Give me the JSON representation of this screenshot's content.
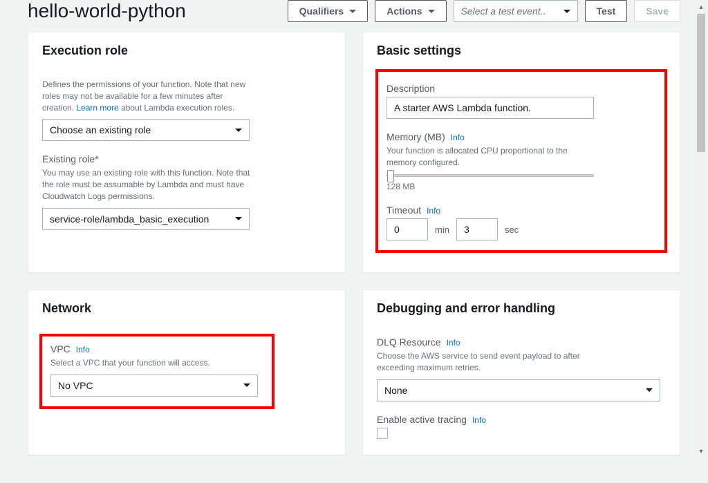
{
  "header": {
    "title": "hello-world-python",
    "qualifiers_label": "Qualifiers",
    "actions_label": "Actions",
    "test_event_placeholder": "Select a test event..",
    "test_label": "Test",
    "save_label": "Save"
  },
  "execution_role": {
    "title": "Execution role",
    "description_prefix": "Defines the permissions of your function. Note that new roles may not be available for a few minutes after creation. ",
    "learn_more": "Learn more",
    "description_suffix": " about Lambda execution roles.",
    "role_select": "Choose an existing role",
    "existing_role_label": "Existing role*",
    "existing_role_help": "You may use an existing role with this function. Note that the role must be assumable by Lambda and must have Cloudwatch Logs permissions.",
    "existing_role_value": "service-role/lambda_basic_execution"
  },
  "basic_settings": {
    "title": "Basic settings",
    "description_label": "Description",
    "description_value": "A starter AWS Lambda function.",
    "memory_label": "Memory (MB)",
    "memory_help": "Your function is allocated CPU proportional to the memory configured.",
    "memory_value": "128 MB",
    "timeout_label": "Timeout",
    "timeout_min": "0",
    "timeout_min_unit": "min",
    "timeout_sec": "3",
    "timeout_sec_unit": "sec",
    "info": "Info"
  },
  "network": {
    "title": "Network",
    "vpc_label": "VPC",
    "vpc_help": "Select a VPC that your function will access.",
    "vpc_value": "No VPC",
    "info": "Info"
  },
  "debugging": {
    "title": "Debugging and error handling",
    "dlq_label": "DLQ Resource",
    "dlq_help": "Choose the AWS service to send event payload to after exceeding maximum retries.",
    "dlq_value": "None",
    "tracing_label": "Enable active tracing",
    "info": "Info"
  }
}
